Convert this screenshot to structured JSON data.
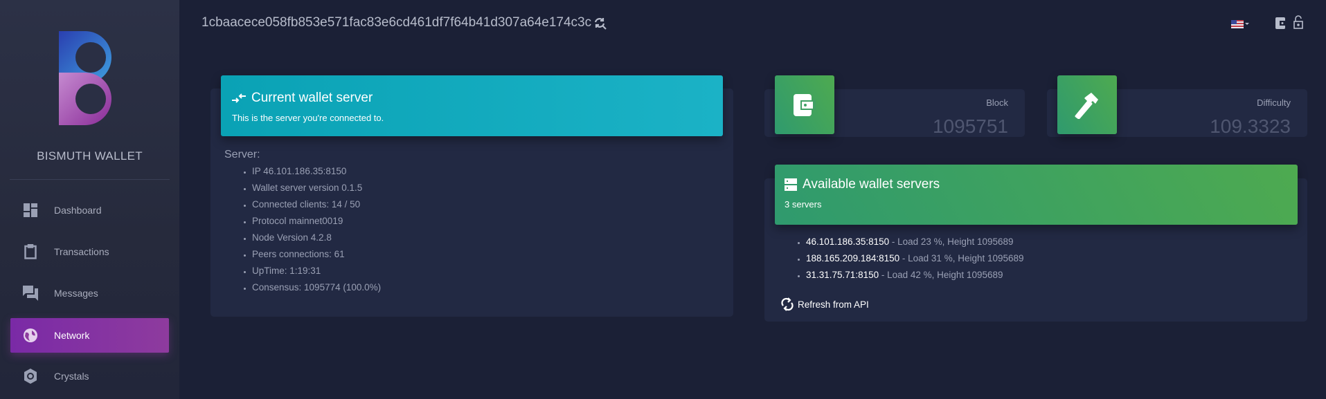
{
  "sidebar": {
    "brand": "BISMUTH WALLET",
    "items": [
      {
        "label": "Dashboard",
        "icon": "dashboard-icon"
      },
      {
        "label": "Transactions",
        "icon": "clipboard-icon"
      },
      {
        "label": "Messages",
        "icon": "forum-icon"
      },
      {
        "label": "Network",
        "icon": "globe-icon",
        "active": true
      },
      {
        "label": "Crystals",
        "icon": "gear-icon"
      }
    ]
  },
  "header": {
    "address": "1cbaacece058fb853e571fac83e6cd461df7f64b41d307a64e174c3c"
  },
  "current_server": {
    "title": "Current wallet server",
    "subtitle": "This is the server you're connected to.",
    "label": "Server:",
    "items": [
      "IP 46.101.186.35:8150",
      "Wallet server version 0.1.5",
      "Connected clients: 14 / 50",
      "Protocol mainnet0019",
      "Node Version 4.2.8",
      "Peers connections: 61",
      "UpTime: 1:19:31",
      "Consensus: 1095774 (100.0%)"
    ]
  },
  "block": {
    "label": "Block",
    "value": "1095751"
  },
  "difficulty": {
    "label": "Difficulty",
    "value": "109.3323"
  },
  "servers": {
    "title": "Available wallet servers",
    "subtitle": "3 servers",
    "refresh_label": "Refresh from API",
    "list": [
      {
        "host": "46.101.186.35:8150",
        "info": " - Load 23 %, Height 1095689"
      },
      {
        "host": "188.165.209.184:8150",
        "info": " - Load 31 %, Height 1095689"
      },
      {
        "host": "31.31.75.71:8150",
        "info": " - Load 42 %, Height 1095689"
      }
    ]
  },
  "colors": {
    "accent_purple": "#8e3b9e",
    "cyan": "#0aa2b5",
    "green": "#4eaa50",
    "bg": "#1b2036"
  }
}
